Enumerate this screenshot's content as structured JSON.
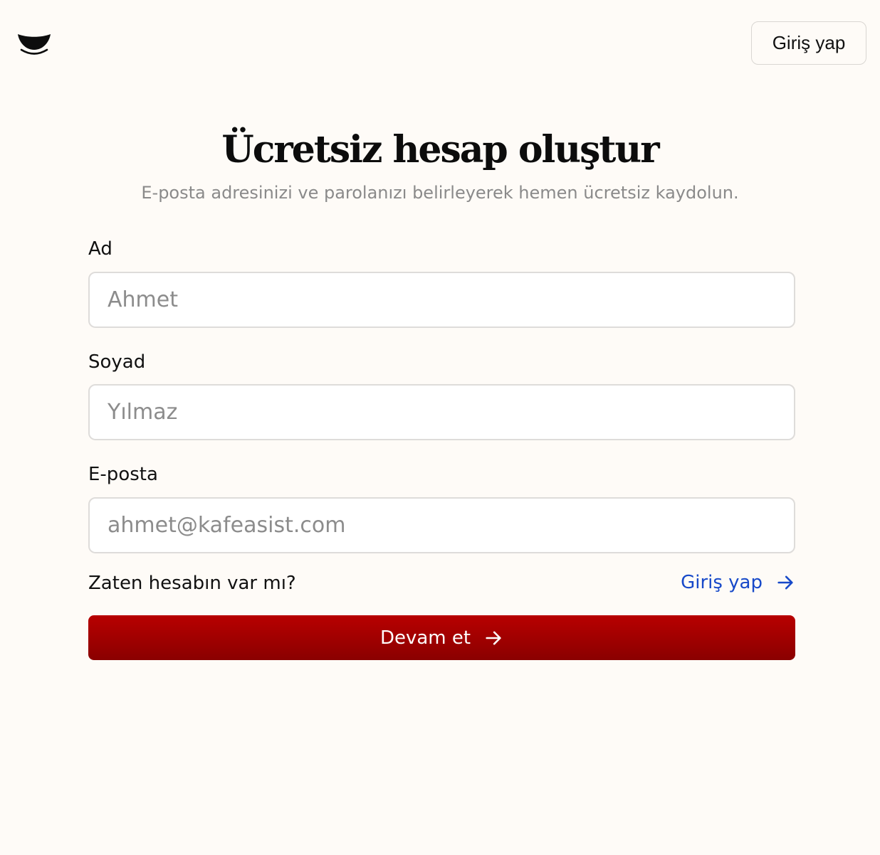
{
  "header": {
    "logo_icon": "bowl-logo-icon",
    "login_button": "Giriş yap"
  },
  "form": {
    "title": "Ücretsiz hesap oluştur",
    "subtitle": "E-posta adresinizi ve parolanızı belirleyerek hemen ücretsiz kaydolun.",
    "fields": [
      {
        "label": "Ad",
        "placeholder": "Ahmet",
        "value": ""
      },
      {
        "label": "Soyad",
        "placeholder": "Yılmaz",
        "value": ""
      },
      {
        "label": "E-posta",
        "placeholder": "ahmet@kafeasist.com",
        "value": ""
      }
    ],
    "have_account_text": "Zaten hesabın var mı?",
    "login_link": "Giriş yap",
    "login_link_icon": "arrow-right-icon",
    "continue_button": "Devam et",
    "continue_icon": "arrow-right-icon"
  },
  "colors": {
    "background": "#fefbf7",
    "accent": "#a80000",
    "link": "#1749c9"
  }
}
